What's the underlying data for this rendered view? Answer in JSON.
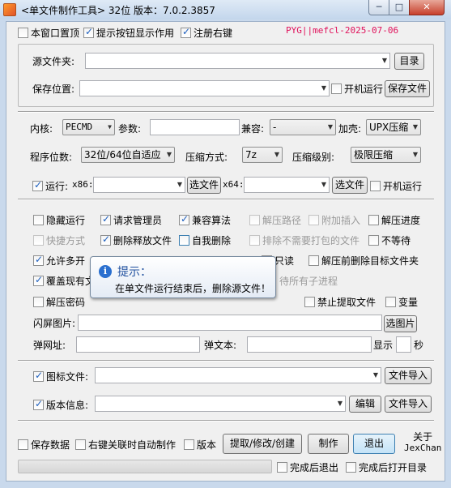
{
  "window": {
    "title": "<单文件制作工具> 32位  版本：7.0.2.3857",
    "min_label": "─",
    "max_label": "□",
    "close_label": "✕"
  },
  "top": {
    "stay_on_top": "本窗口置顶",
    "tooltip_buttons": "提示按钮显示作用",
    "register_right_click": "注册右键",
    "signature": "PYG||mefcl-2025-07-06"
  },
  "source": {
    "source_folder_label": "源文件夹:",
    "browse_dir_button": "目录",
    "save_location_label": "保存位置:",
    "startup_run": "开机运行",
    "save_file_button": "保存文件"
  },
  "options": {
    "kernel_label": "内核:",
    "kernel_value": "PECMD",
    "params_label": "参数:",
    "compat_label": "兼容:",
    "compat_value": "-",
    "shell_label": "加壳:",
    "shell_value": "UPX压缩",
    "arch_label": "程序位数:",
    "arch_value": "32位/64位自适应",
    "compress_method_label": "压缩方式:",
    "compress_method_value": "7z",
    "compress_level_label": "压缩级别:",
    "compress_level_value": "极限压缩",
    "run_label": "运行:",
    "x86_label": "x86:",
    "select_file_button": "选文件",
    "x64_label": "x64:",
    "startup_run": "开机运行"
  },
  "flags": {
    "hidden_run": "隐藏运行",
    "request_admin": "请求管理员",
    "compat_algo": "兼容算法",
    "extract_path": "解压路径",
    "attach_insert": "附加插入",
    "extract_progress": "解压进度",
    "shortcut": "快捷方式",
    "delete_released": "删除释放文件",
    "self_delete": "自我删除",
    "exclude_unneeded": "排除不需要打包的文件",
    "no_wait": "不等待",
    "allow_multi": "允许多开",
    "readonly": "只读",
    "delete_target_before": "解压前删除目标文件夹",
    "overwrite_existing": "覆盖现有文",
    "wait_all_children": "待所有子进程",
    "extract_password": "解压密码",
    "forbid_extract": "禁止提取文件",
    "mutate": "变量",
    "splash_label": "闪屏图片:",
    "select_image_button": "选图片",
    "popup_url_label": "弹网址:",
    "popup_text_label": "弹文本:",
    "show_label": "显示",
    "seconds_label": "秒"
  },
  "tooltip": {
    "title": "提示：",
    "body": "在单文件运行结束后，删除源文件！"
  },
  "icon_version": {
    "icon_file_label": "图标文件:",
    "import_file_button": "文件导入",
    "version_info_label": "版本信息:",
    "edit_button": "编辑"
  },
  "bottom": {
    "save_data": "保存数据",
    "right_click_auto": "右键关联时自动制作",
    "version": "版本",
    "extract_edit_create": "提取/修改/创建",
    "make": "制作",
    "exit": "退出",
    "about": "关于",
    "author": "JexChan",
    "exit_when_done": "完成后退出",
    "open_dir_when_done": "完成后打开目录"
  }
}
